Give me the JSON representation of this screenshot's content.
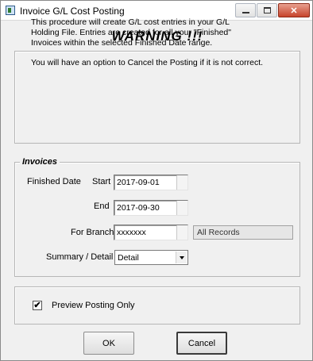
{
  "window": {
    "title": "Invoice G/L Cost Posting",
    "controls": {
      "minimize": "",
      "maximize": "",
      "close": "✕"
    }
  },
  "warning": "WARNING !!!",
  "info": {
    "lines": [
      "This procedure will create G/L cost entries in your G/L",
      "Holding File. Entries are created for all your \"Finished\"",
      "Invoices within the selected Finished Date range.",
      "You will have an option to Cancel the Posting if it is not correct."
    ]
  },
  "invoices": {
    "legend": "Invoices",
    "finished_date_label": "Finished Date",
    "start_label": "Start",
    "start_value": "2017-09-01",
    "end_label": "End",
    "end_value": "2017-09-30",
    "branch_label": "For Branch",
    "branch_value": "xxxxxxx",
    "branch_description": "All Records",
    "summary_label": "Summary / Detail",
    "summary_value": "Detail"
  },
  "preview": {
    "checked": true,
    "check_glyph": "✔",
    "label": "Preview Posting Only"
  },
  "buttons": {
    "ok": "OK",
    "cancel": "Cancel"
  }
}
